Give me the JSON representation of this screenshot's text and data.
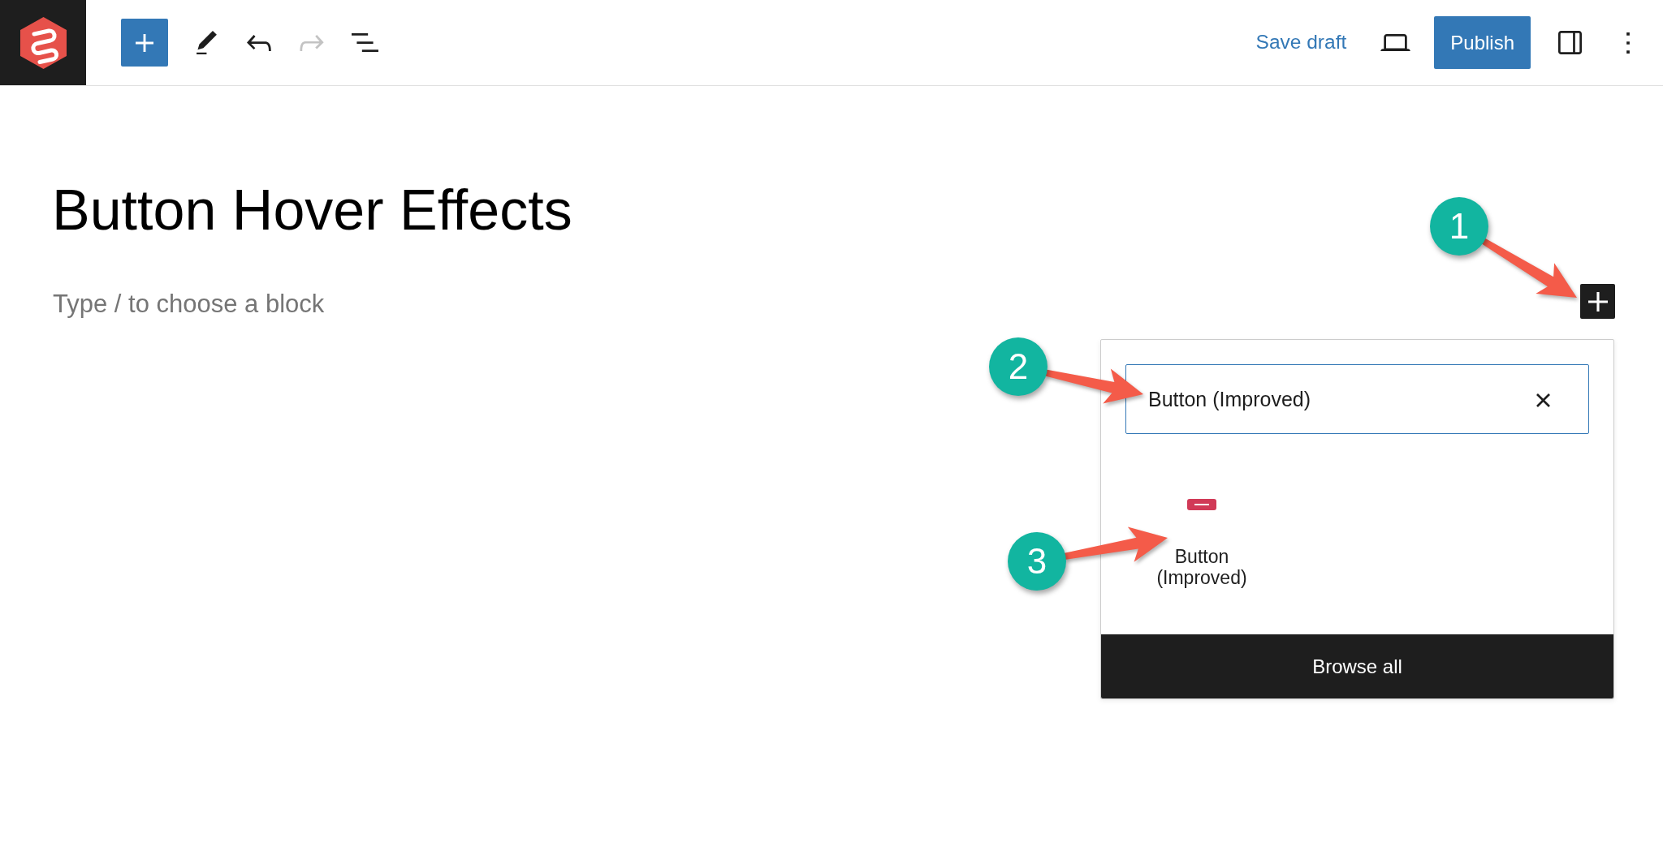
{
  "toolbar": {
    "undo": {
      "disabled": false
    },
    "redo": {
      "disabled": true
    },
    "save_draft": "Save draft",
    "publish": "Publish"
  },
  "editor": {
    "title": "Button Hover Effects",
    "placeholder": "Type / to choose a block"
  },
  "inserter": {
    "search": {
      "value": "Button (Improved)"
    },
    "results": [
      {
        "label": "Button (Improved)"
      }
    ],
    "browse_all": "Browse all"
  },
  "annotations": [
    {
      "number": "1"
    },
    {
      "number": "2"
    },
    {
      "number": "3"
    }
  ]
}
